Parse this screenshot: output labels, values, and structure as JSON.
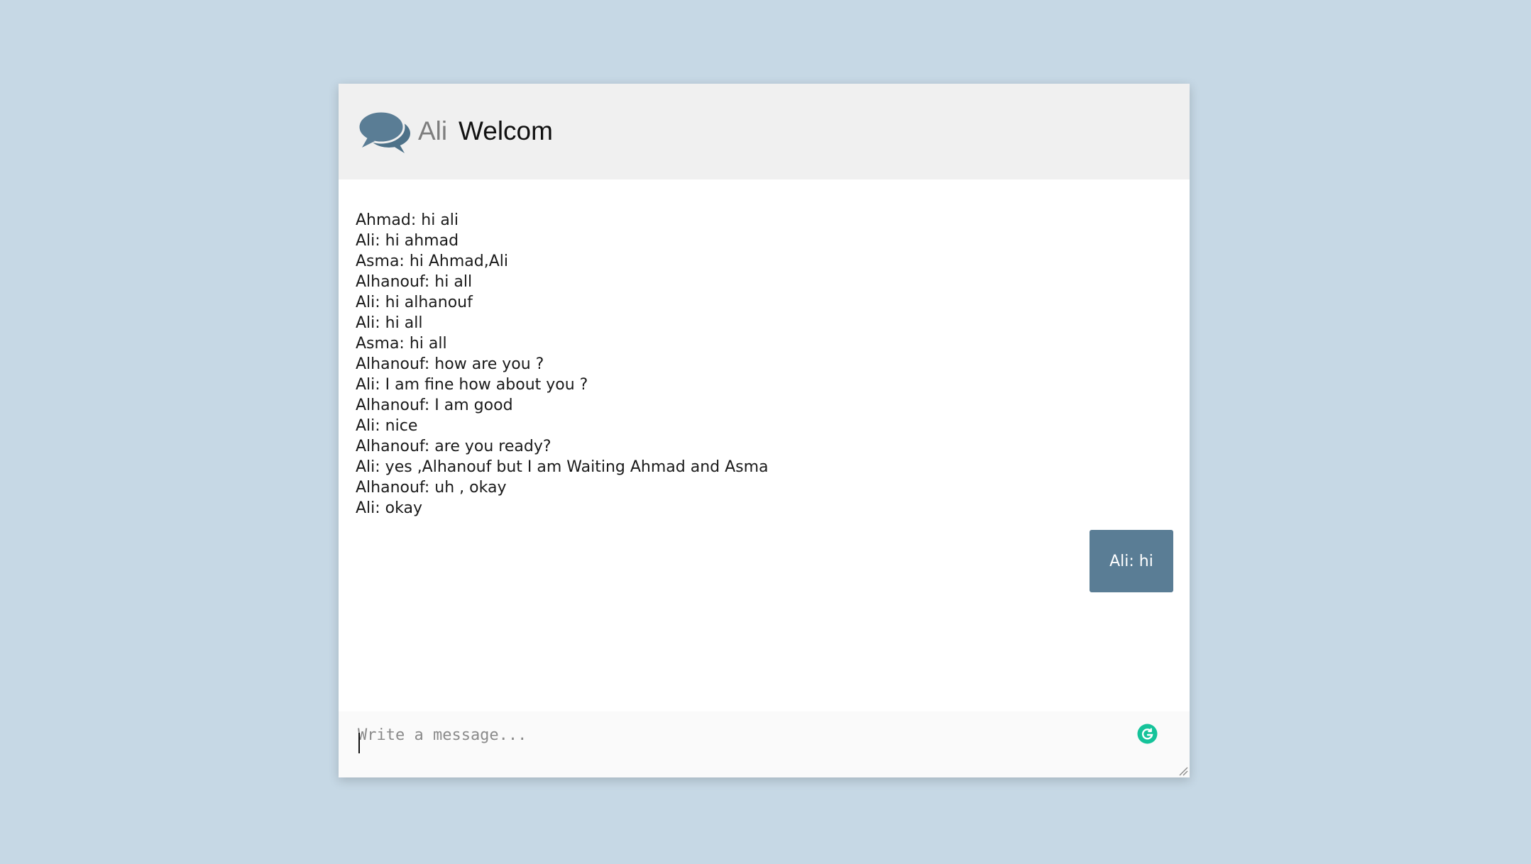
{
  "header": {
    "icon": "chat-bubbles-icon",
    "user_name": "Ali",
    "title": "Welcom"
  },
  "messages": [
    "Ahmad: hi ali",
    "Ali: hi ahmad",
    "Asma: hi Ahmad,Ali",
    "Alhanouf: hi all",
    "Ali: hi alhanouf",
    "Ali: hi all",
    "Asma: hi all",
    "Alhanouf: how are you ?",
    "Ali: I am fine how about you ?",
    "Alhanouf: I am good",
    "Ali: nice",
    "Alhanouf: are you ready?",
    "Ali: yes ,Alhanouf but I am Waiting Ahmad and Asma",
    "Alhanouf: uh , okay",
    "Ali: okay"
  ],
  "own_message": {
    "text": "Ali: hi"
  },
  "composer": {
    "placeholder": "Write a message...",
    "value": ""
  },
  "colors": {
    "page_background": "#c6d8e5",
    "header_background": "#f0f0f0",
    "accent": "#5a7d95",
    "grammarly": "#15c39a"
  }
}
